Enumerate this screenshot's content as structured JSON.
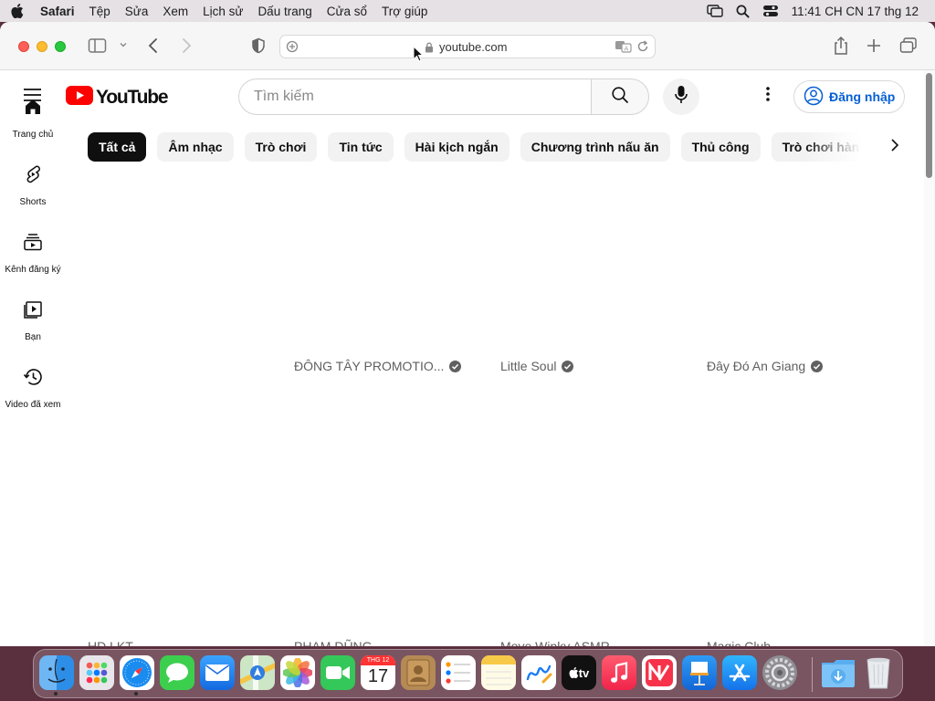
{
  "menubar": {
    "app_name": "Safari",
    "items": [
      "Tệp",
      "Sửa",
      "Xem",
      "Lịch sử",
      "Dấu trang",
      "Cửa sổ",
      "Trợ giúp"
    ],
    "clock": "11:41 CH CN 17 thg 12"
  },
  "browser": {
    "url": "youtube.com"
  },
  "youtube": {
    "logo_text": "YouTube",
    "search_placeholder": "Tìm kiếm",
    "signin_label": "Đăng nhập",
    "chips": [
      "Tất cả",
      "Âm nhạc",
      "Trò chơi",
      "Tin tức",
      "Hài kịch ngắn",
      "Chương trình nấu ăn",
      "Thủ công",
      "Trò chơi hành động"
    ],
    "active_chip": 0,
    "sidebar": [
      "Trang chủ",
      "Shorts",
      "Kênh đăng ký",
      "Bạn",
      "Video đã xem"
    ],
    "channels": [
      "ĐÔNG TÂY PROMOTIO...",
      "Little Soul",
      "Đây Đó An Giang"
    ],
    "next_row_channels": [
      "HD LKT",
      "PHẠM DŨNG",
      "Move Winky ASMR",
      "Magic Club"
    ],
    "brand_color": "#ff0000",
    "link_color": "#065fd4"
  },
  "dock": {
    "calendar_month": "THG 12",
    "calendar_day": "17",
    "tv_label": "tv"
  }
}
